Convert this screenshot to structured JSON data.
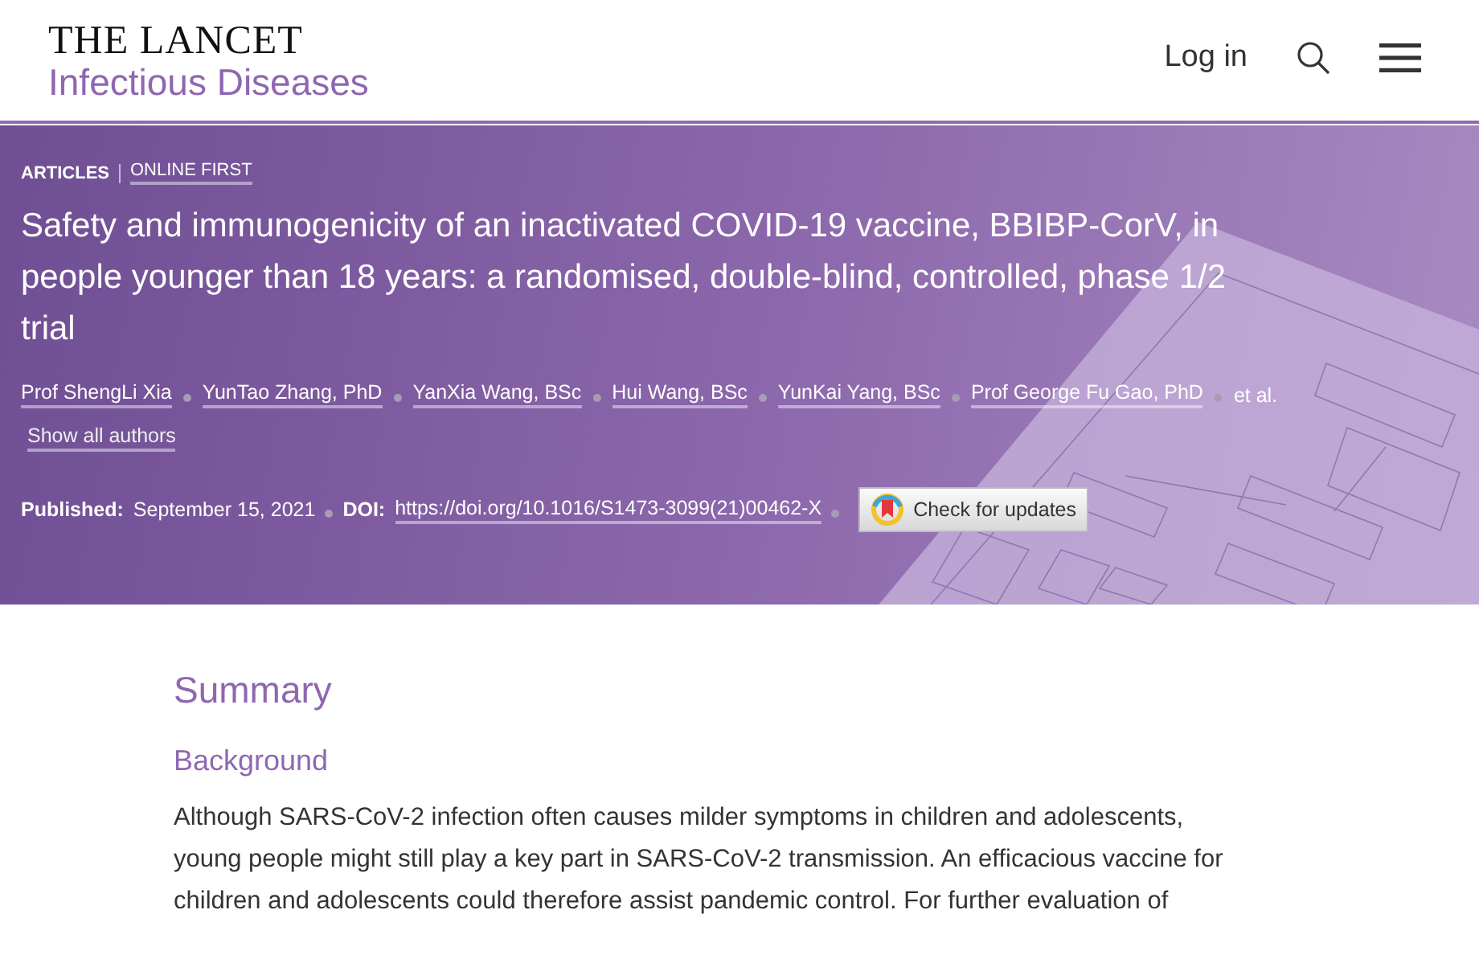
{
  "header": {
    "brand": "THE LANCET",
    "journal": "Infectious Diseases",
    "login": "Log in"
  },
  "hero": {
    "kind": "picture",
    "section": "ARTICLES",
    "subsection": "ONLINE FIRST",
    "title": "Safety and immunogenicity of an inactivated COVID-19 vaccine, BBIBP-CorV, in people younger than 18 years: a randomised, double-blind, controlled, phase 1/2 trial",
    "authors": [
      "Prof ShengLi Xia",
      "YunTao Zhang, PhD",
      "YanXia Wang, BSc",
      "Hui Wang, BSc",
      "YunKai Yang, BSc",
      "Prof George Fu Gao, PhD"
    ],
    "et_al": "et al.",
    "show_all": "Show all authors",
    "published_label": "Published:",
    "published_date": "September 15, 2021",
    "doi_label": "DOI:",
    "doi": "https://doi.org/10.1016/S1473-3099(21)00462-X",
    "updates_button": "Check for updates"
  },
  "summary": {
    "heading": "Summary",
    "subheading": "Background",
    "text": "Although SARS-CoV-2 infection often causes milder symptoms in children and adolescents, young people might still play a key part in SARS-CoV-2 transmission. An efficacious vaccine for children and adolescents could therefore assist pandemic control. For further evaluation of"
  }
}
